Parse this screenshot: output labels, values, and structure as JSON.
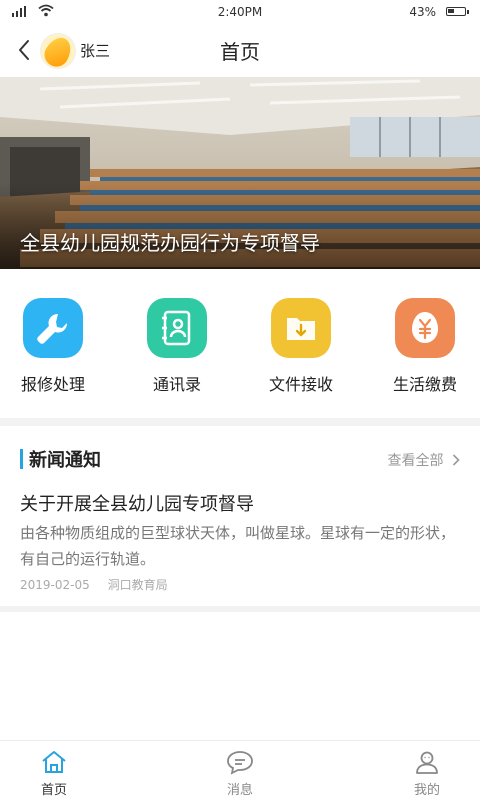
{
  "status_bar": {
    "time": "2:40PM",
    "battery": "43%",
    "battery_level": 0.43
  },
  "header": {
    "user_name": "张三",
    "title": "首页"
  },
  "banner": {
    "caption": "全县幼儿园规范办园行为专项督导"
  },
  "quick_actions": [
    {
      "label": "报修处理",
      "icon": "wrench-icon",
      "color": "#2fb4f3"
    },
    {
      "label": "通讯录",
      "icon": "contacts-book-icon",
      "color": "#2fcaa4"
    },
    {
      "label": "文件接收",
      "icon": "folder-download-icon",
      "color": "#f1c232"
    },
    {
      "label": "生活缴费",
      "icon": "yuan-bag-icon",
      "color": "#f08a54"
    }
  ],
  "news": {
    "section_title": "新闻通知",
    "view_all": "查看全部",
    "items": [
      {
        "title": "关于开展全县幼儿园专项督导",
        "summary": "由各种物质组成的巨型球状天体，叫做星球。星球有一定的形状，有自己的运行轨道。",
        "date": "2019-02-05",
        "source": "洞口教育局"
      }
    ]
  },
  "tabbar": {
    "items": [
      {
        "label": "首页",
        "icon": "home-icon",
        "active": true
      },
      {
        "label": "消息",
        "icon": "chat-bubble-icon",
        "active": false
      },
      {
        "label": "我的",
        "icon": "user-icon",
        "active": false
      }
    ]
  },
  "colors": {
    "accent": "#27a3e0",
    "divider": "#f2f2f2"
  }
}
